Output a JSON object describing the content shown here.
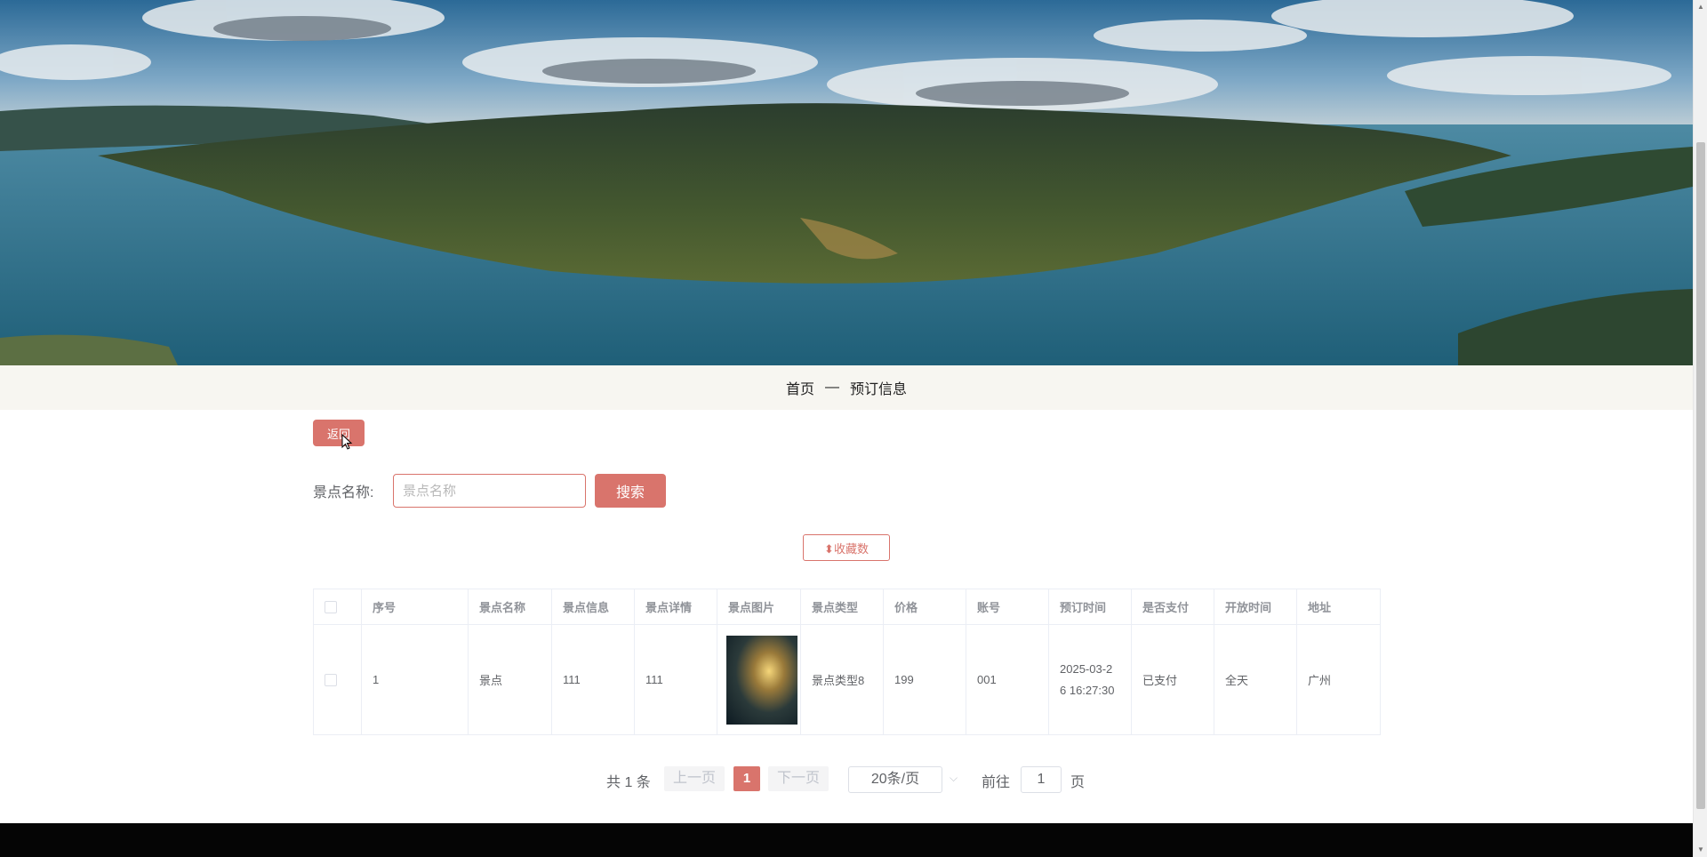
{
  "breadcrumb": {
    "home": "首页",
    "separator": "—",
    "current": "预订信息"
  },
  "back_button": {
    "label": "返回"
  },
  "search": {
    "label": "景点名称:",
    "placeholder": "景点名称",
    "value": "",
    "button": "搜索"
  },
  "sort_button": {
    "icon": "sort-icon",
    "label": "收藏数"
  },
  "table": {
    "columns": [
      "序号",
      "景点名称",
      "景点信息",
      "景点详情",
      "景点图片",
      "景点类型",
      "价格",
      "账号",
      "预订时间",
      "是否支付",
      "开放时间",
      "地址"
    ],
    "rows": [
      {
        "index": "1",
        "name": "景点",
        "info": "111",
        "details": "111",
        "image": "scenic-thumbnail",
        "type": "景点类型8",
        "price": "199",
        "account": "001",
        "booking_time_line1": "2025-03-2",
        "booking_time_line2": "6 16:27:30",
        "paid": "已支付",
        "open_time": "全天",
        "address": "广州"
      }
    ]
  },
  "pagination": {
    "total": "共 1 条",
    "prev": "上一页",
    "current_page": "1",
    "next": "下一页",
    "page_size": "20条/页",
    "goto_label": "前往",
    "goto_value": "1",
    "page_unit": "页"
  },
  "colors": {
    "accent": "#d9746c",
    "breadcrumb_bg": "#f7f6f1",
    "footer_bg": "#050505"
  }
}
